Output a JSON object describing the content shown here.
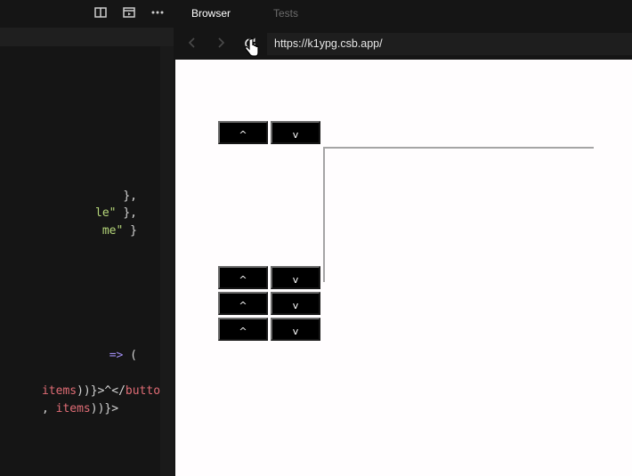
{
  "editor": {
    "code_lines": [
      {
        "parts": [
          {
            "t": " },",
            "c": "punc"
          }
        ]
      },
      {
        "parts": [
          {
            "t": "le\"",
            "c": "str"
          },
          {
            "t": " },",
            "c": "punc"
          }
        ]
      },
      {
        "parts": [
          {
            "t": "me\"",
            "c": "str"
          },
          {
            "t": " }",
            "c": "punc"
          }
        ]
      },
      {
        "parts": [
          {
            "t": "=>",
            "c": "kw"
          },
          {
            "t": " (",
            "c": "punc"
          }
        ]
      },
      {
        "parts": [
          {
            "t": "items",
            "c": "red"
          },
          {
            "t": "))}>^</",
            "c": "punc"
          },
          {
            "t": "button",
            "c": "red"
          },
          {
            "t": ">",
            "c": "punc"
          }
        ]
      },
      {
        "parts": [
          {
            "t": ", ",
            "c": "punc"
          },
          {
            "t": "items",
            "c": "red"
          },
          {
            "t": "))}>",
            "c": "punc"
          }
        ]
      }
    ]
  },
  "browser": {
    "tabs": {
      "browser": "Browser",
      "tests": "Tests"
    },
    "url": "https://k1ypg.csb.app/"
  },
  "preview": {
    "rows": [
      {
        "up": "^",
        "down": "v"
      },
      {
        "up": "^",
        "down": "v"
      },
      {
        "up": "^",
        "down": "v"
      },
      {
        "up": "^",
        "down": "v"
      }
    ]
  },
  "icons": {
    "layout": "split-layout-icon",
    "preview": "preview-window-icon",
    "more": "more-icon",
    "back": "back-arrow-icon",
    "forward": "forward-arrow-icon",
    "refresh": "refresh-icon"
  }
}
